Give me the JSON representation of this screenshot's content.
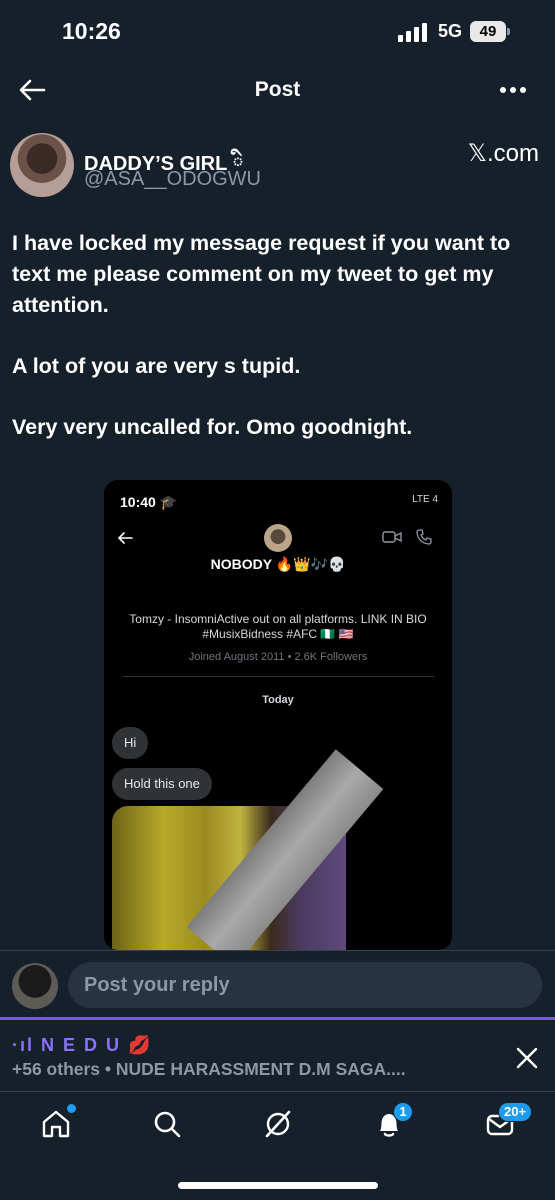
{
  "status": {
    "time": "10:26",
    "network": "5G",
    "battery": "49"
  },
  "header": {
    "title": "Post",
    "back_icon": "arrow-left-icon",
    "more_icon": "more-horizontal-icon"
  },
  "post": {
    "display_name": "DADDY’S GIRL ི",
    "handle": "@ASA__ODOGWU",
    "source": "𝕏.com",
    "paragraphs": [
      "I have locked my message request if you want to text me please comment on my tweet to get my attention.",
      "A lot of you are very s tupid.",
      "Very very uncalled for. Omo goodnight."
    ]
  },
  "media": {
    "time": "10:40 🎓",
    "network": "LTE 4",
    "profile_name": "NOBODY 🔥👑🎶💀",
    "bio": "Tomzy - InsomniActive out on all platforms. LINK IN BIO #MusixBidness #AFC 🇳🇬 🇺🇸",
    "joined": "Joined August 2011 • 2.6K Followers",
    "today": "Today",
    "messages": [
      "Hi",
      "Hold this one"
    ]
  },
  "reply": {
    "placeholder": "Post your reply"
  },
  "space": {
    "title": "·ıl N E D U 💋",
    "subtitle": "+56 others • NUDE HARASSMENT D.M SAGA....",
    "close_icon": "close-icon",
    "accent": "#7856ff"
  },
  "tabs": {
    "notifications_badge": "1",
    "messages_badge": "20+"
  },
  "colors": {
    "background": "#15202b",
    "secondary_text": "#8b98a5",
    "accent_blue": "#1d9bf0"
  }
}
